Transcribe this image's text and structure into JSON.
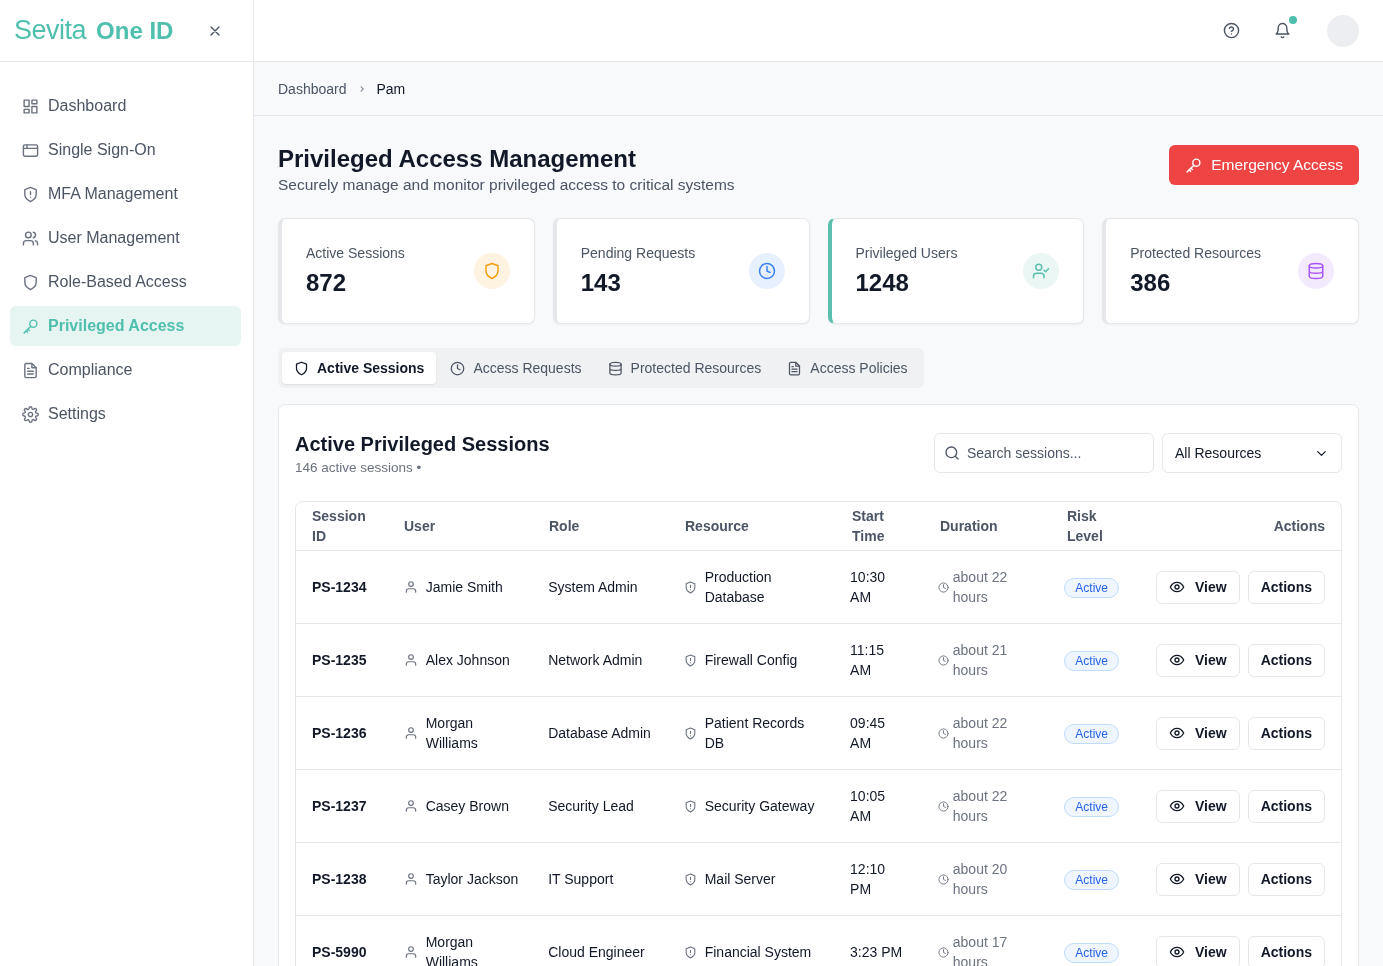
{
  "brand": {
    "name": "Sevita",
    "product": "One ID"
  },
  "sidebar": {
    "items": [
      {
        "label": "Dashboard",
        "kind": "grid",
        "selected": false
      },
      {
        "label": "Single Sign-On",
        "kind": "browser",
        "selected": false
      },
      {
        "label": "MFA Management",
        "kind": "shield-alert",
        "selected": false
      },
      {
        "label": "User Management",
        "kind": "users",
        "selected": false
      },
      {
        "label": "Role-Based Access",
        "kind": "shield",
        "selected": false
      },
      {
        "label": "Privileged Access",
        "kind": "key",
        "selected": true
      },
      {
        "label": "Compliance",
        "kind": "file",
        "selected": false
      },
      {
        "label": "Settings",
        "kind": "gear",
        "selected": false
      }
    ]
  },
  "topbar": {
    "notification_dot": true
  },
  "breadcrumb": [
    "Dashboard",
    "Pam"
  ],
  "page": {
    "title": "Privileged Access Management",
    "subtitle": "Securely manage and monitor privileged access to critical systems",
    "primary_button": "Emergency Access"
  },
  "stats": [
    {
      "label": "Active Sessions",
      "value": "872",
      "kind": "shield",
      "color": "#f59e0b",
      "highlighted": false
    },
    {
      "label": "Pending Requests",
      "value": "143",
      "kind": "clock",
      "color": "#3b82f6",
      "highlighted": false
    },
    {
      "label": "Privileged Users",
      "value": "1248",
      "kind": "user-check",
      "color": "#5bbfae",
      "highlighted": true
    },
    {
      "label": "Protected Resources",
      "value": "386",
      "kind": "database",
      "color": "#a855f7",
      "highlighted": false
    }
  ],
  "tabs": [
    {
      "label": "Active Sessions",
      "kind": "shield",
      "selected": true
    },
    {
      "label": "Access Requests",
      "kind": "clock",
      "selected": false
    },
    {
      "label": "Protected Resources",
      "kind": "database",
      "selected": false
    },
    {
      "label": "Access Policies",
      "kind": "file",
      "selected": false
    }
  ],
  "panel": {
    "title": "Active Privileged Sessions",
    "subtitle": "146 active sessions •",
    "search": {
      "placeholder": "Search sessions..."
    },
    "filter": "All Resources"
  },
  "table": {
    "columns": [
      "Session ID",
      "User",
      "Role",
      "Resource",
      "Start Time",
      "Duration",
      "Risk Level",
      "Actions"
    ],
    "rows": [
      {
        "id": "PS-1234",
        "user": "Jamie Smith",
        "role": "System Admin",
        "resource": "Production Database",
        "start": "10:30 AM",
        "duration": "about 22 hours",
        "status": "Active",
        "view": "View",
        "actions": "Actions"
      },
      {
        "id": "PS-1235",
        "user": "Alex Johnson",
        "role": "Network Admin",
        "resource": "Firewall Config",
        "start": "11:15 AM",
        "duration": "about 21 hours",
        "status": "Active",
        "view": "View",
        "actions": "Actions"
      },
      {
        "id": "PS-1236",
        "user": "Morgan Williams",
        "role": "Database Admin",
        "resource": "Patient Records DB",
        "start": "09:45 AM",
        "duration": "about 22 hours",
        "status": "Active",
        "view": "View",
        "actions": "Actions"
      },
      {
        "id": "PS-1237",
        "user": "Casey Brown",
        "role": "Security Lead",
        "resource": "Security Gateway",
        "start": "10:05 AM",
        "duration": "about 22 hours",
        "status": "Active",
        "view": "View",
        "actions": "Actions"
      },
      {
        "id": "PS-1238",
        "user": "Taylor Jackson",
        "role": "IT Support",
        "resource": "Mail Server",
        "start": "12:10 PM",
        "duration": "about 20 hours",
        "status": "Active",
        "view": "View",
        "actions": "Actions"
      },
      {
        "id": "PS-5990",
        "user": "Morgan Williams",
        "role": "Cloud Engineer",
        "resource": "Financial System",
        "start": "3:23 PM",
        "duration": "about 17 hours",
        "status": "Active",
        "view": "View",
        "actions": "Actions"
      }
    ]
  }
}
